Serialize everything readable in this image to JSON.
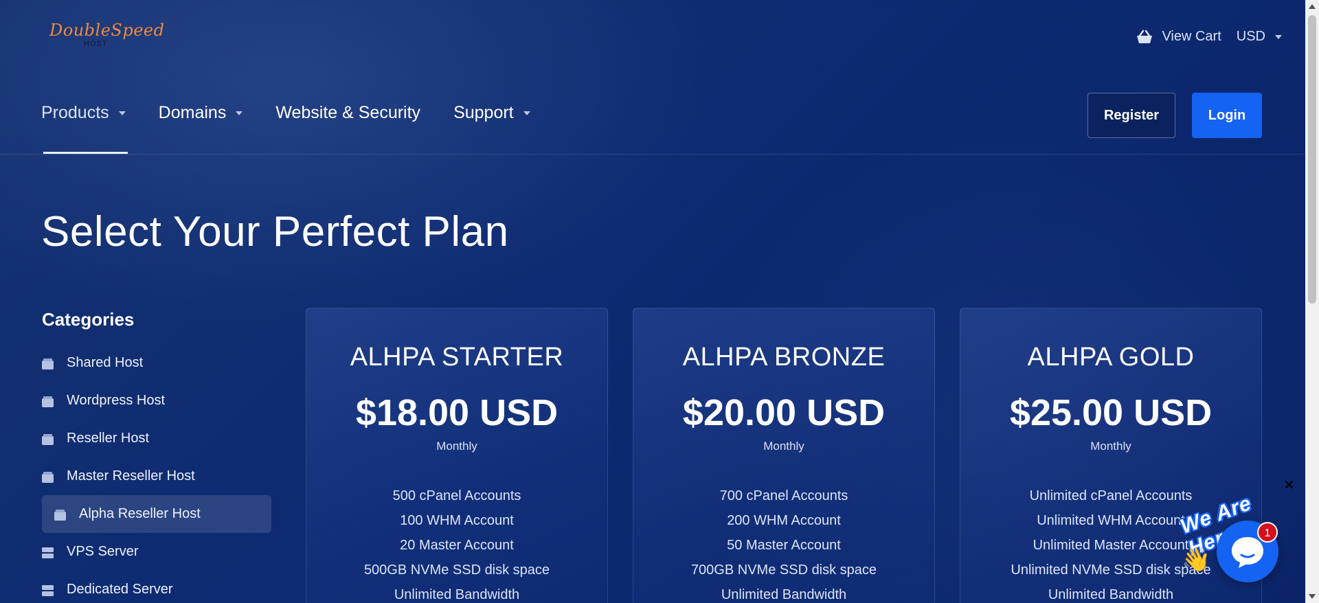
{
  "brand": {
    "logo_main": "DoubleSpeed",
    "logo_sub": "HOST"
  },
  "top_right": {
    "cart_label": "View Cart",
    "currency": "USD"
  },
  "nav": {
    "items": [
      {
        "label": "Products",
        "dropdown": true,
        "active": true
      },
      {
        "label": "Domains",
        "dropdown": true,
        "active": false
      },
      {
        "label": "Website & Security",
        "dropdown": false,
        "active": false
      },
      {
        "label": "Support",
        "dropdown": true,
        "active": false
      }
    ],
    "register_label": "Register",
    "login_label": "Login"
  },
  "page": {
    "title": "Select Your Perfect Plan"
  },
  "sidebar": {
    "heading": "Categories",
    "items": [
      {
        "label": "Shared Host",
        "icon": "box-icon"
      },
      {
        "label": "Wordpress Host",
        "icon": "box-icon"
      },
      {
        "label": "Reseller Host",
        "icon": "box-icon"
      },
      {
        "label": "Master Reseller Host",
        "icon": "box-icon"
      },
      {
        "label": "Alpha Reseller Host",
        "icon": "box-icon",
        "selected": true
      },
      {
        "label": "VPS Server",
        "icon": "server-icon"
      },
      {
        "label": "Dedicated Server",
        "icon": "server-icon"
      }
    ]
  },
  "plans": [
    {
      "name": "ALHPA STARTER",
      "price": "$18.00 USD",
      "cycle": "Monthly",
      "features": [
        "500 cPanel Accounts",
        "100 WHM Account",
        "20 Master Account",
        "500GB NVMe SSD disk space",
        "Unlimited Bandwidth"
      ]
    },
    {
      "name": "ALHPA BRONZE",
      "price": "$20.00 USD",
      "cycle": "Monthly",
      "features": [
        "700 cPanel Accounts",
        "200 WHM Account",
        "50 Master Account",
        "700GB NVMe SSD disk space",
        "Unlimited Bandwidth"
      ]
    },
    {
      "name": "ALHPA GOLD",
      "price": "$25.00 USD",
      "cycle": "Monthly",
      "features": [
        "Unlimited cPanel Accounts",
        "Unlimited WHM Account",
        "Unlimited Master Account",
        "Unlimited NVMe SSD disk space",
        "Unlimited Bandwidth"
      ]
    }
  ],
  "chat": {
    "tagline": "We Are Here!",
    "badge_count": "1",
    "close_glyph": "✕"
  },
  "colors": {
    "accent": "#1463f3",
    "brand_orange": "#f08a3a",
    "badge_red": "#d3101e"
  }
}
